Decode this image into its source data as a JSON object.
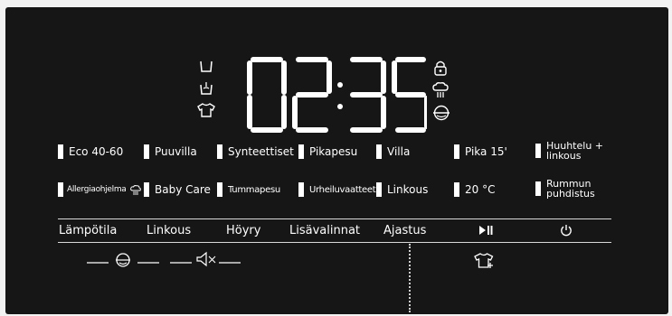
{
  "display": {
    "time": "02:35",
    "left_icons": [
      "detergent-icon",
      "prewash-icon",
      "shirt-icon"
    ],
    "right_icons": [
      "lock-icon",
      "steam-icon",
      "drum-icon"
    ]
  },
  "programs": {
    "row1": [
      "Eco 40-60",
      "Puuvilla",
      "Synteettiset",
      "Pikapesu",
      "Villa",
      "Pika 15'",
      "Huuhtelu + linkous"
    ],
    "row2": [
      "Allergiaohjelma",
      "Baby Care",
      "Tummapesu",
      "Urheiluvaatteet",
      "Linkous",
      "20 °C",
      "Rummun puhdistus"
    ]
  },
  "controls": {
    "temperature": "Lämpötila",
    "spin": "Linkous",
    "steam": "Höyry",
    "options": "Lisävalinnat",
    "timer": "Ajastus",
    "start_pause_icon": "play-pause-icon",
    "power_icon": "power-icon"
  },
  "indicators": [
    "drum-clean-indicator-icon",
    "mute-icon",
    "shirt-plus-icon"
  ]
}
